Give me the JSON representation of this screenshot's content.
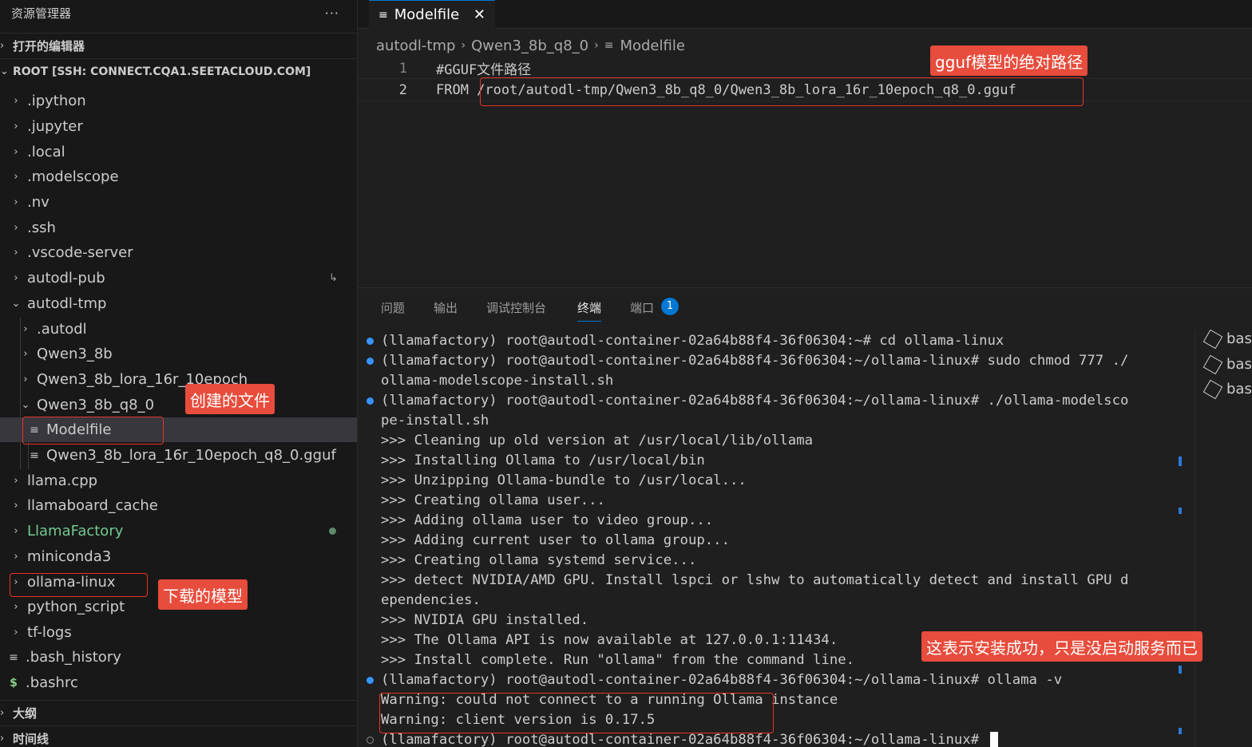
{
  "explorer": {
    "title": "资源管理器",
    "more": "···",
    "open_editors": "打开的编辑器",
    "root": "ROOT [SSH: CONNECT.CQA1.SEETACLOUD.COM]",
    "items": [
      ".ipython",
      ".jupyter",
      ".local",
      ".modelscope",
      ".nv",
      ".ssh",
      ".vscode-server",
      "autodl-pub",
      "autodl-tmp",
      ".autodl",
      "Qwen3_8b",
      "Qwen3_8b_lora_16r_10epoch",
      "Qwen3_8b_q8_0",
      "Modelfile",
      "Qwen3_8b_lora_16r_10epoch_q8_0.gguf",
      "llama.cpp",
      "llamaboard_cache",
      "LlamaFactory",
      "miniconda3",
      "ollama-linux",
      "python_script",
      "tf-logs",
      ".bash_history",
      ".bashrc"
    ],
    "outline": "大纲",
    "timeline": "时间线"
  },
  "tab": {
    "label": "Modelfile",
    "close": "✕"
  },
  "breadcrumb": [
    "autodl-tmp",
    "Qwen3_8b_q8_0",
    "Modelfile"
  ],
  "editor": {
    "lines": [
      {
        "num": "1",
        "text": "#GGUF文件路径"
      },
      {
        "num": "2",
        "text": "FROM /root/autodl-tmp/Qwen3_8b_q8_0/Qwen3_8b_lora_16r_10epoch_q8_0.gguf"
      }
    ]
  },
  "panel": {
    "tabs": [
      "问题",
      "输出",
      "调试控制台",
      "终端",
      "端口"
    ],
    "ports_count": "1",
    "terminal_list": [
      "bas",
      "bas",
      "bas"
    ]
  },
  "terminal": {
    "lines": [
      "(llamafactory) root@autodl-container-02a64b88f4-36f06304:~# cd ollama-linux",
      "(llamafactory) root@autodl-container-02a64b88f4-36f06304:~/ollama-linux# sudo chmod 777 ./",
      "ollama-modelscope-install.sh",
      "(llamafactory) root@autodl-container-02a64b88f4-36f06304:~/ollama-linux# ./ollama-modelsco",
      "pe-install.sh",
      ">>> Cleaning up old version at /usr/local/lib/ollama",
      ">>> Installing Ollama to /usr/local/bin",
      ">>> Unzipping Ollama-bundle to /usr/local...",
      ">>> Creating ollama user...",
      ">>> Adding ollama user to video group...",
      ">>> Adding current user to ollama group...",
      ">>> Creating ollama systemd service...",
      ">>> detect NVIDIA/AMD GPU. Install lspci or lshw to automatically detect and install GPU d",
      "ependencies.",
      ">>> NVIDIA GPU installed.",
      ">>> The Ollama API is now available at 127.0.0.1:11434.",
      ">>> Install complete. Run \"ollama\" from the command line.",
      "(llamafactory) root@autodl-container-02a64b88f4-36f06304:~/ollama-linux# ollama -v",
      "Warning: could not connect to a running Ollama instance",
      "Warning: client version is 0.17.5",
      "(llamafactory) root@autodl-container-02a64b88f4-36f06304:~/ollama-linux# "
    ]
  },
  "annotations": {
    "gguf_path": "gguf模型的绝对路径",
    "created_file": "创建的文件",
    "downloaded_model": "下载的模型",
    "install_success": "这表示安装成功，只是没启动服务而已"
  },
  "colors": {
    "accent": "#0078d4",
    "annotation": "#e74c3c",
    "git_untracked": "#73c991"
  }
}
